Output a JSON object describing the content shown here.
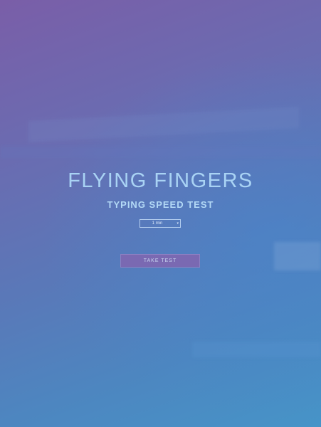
{
  "app": {
    "title": "FLYING FINGERS",
    "subtitle": "TYPING SPEED TEST"
  },
  "duration_select": {
    "selected": "1 min",
    "caret_icon": "▾"
  },
  "actions": {
    "take_test_label": "TAKE TEST"
  },
  "colors": {
    "title": "#a9d3f4",
    "button_bg": "#7a69b2",
    "bg_top": "#7a5ea8",
    "bg_bottom": "#4694c8"
  }
}
